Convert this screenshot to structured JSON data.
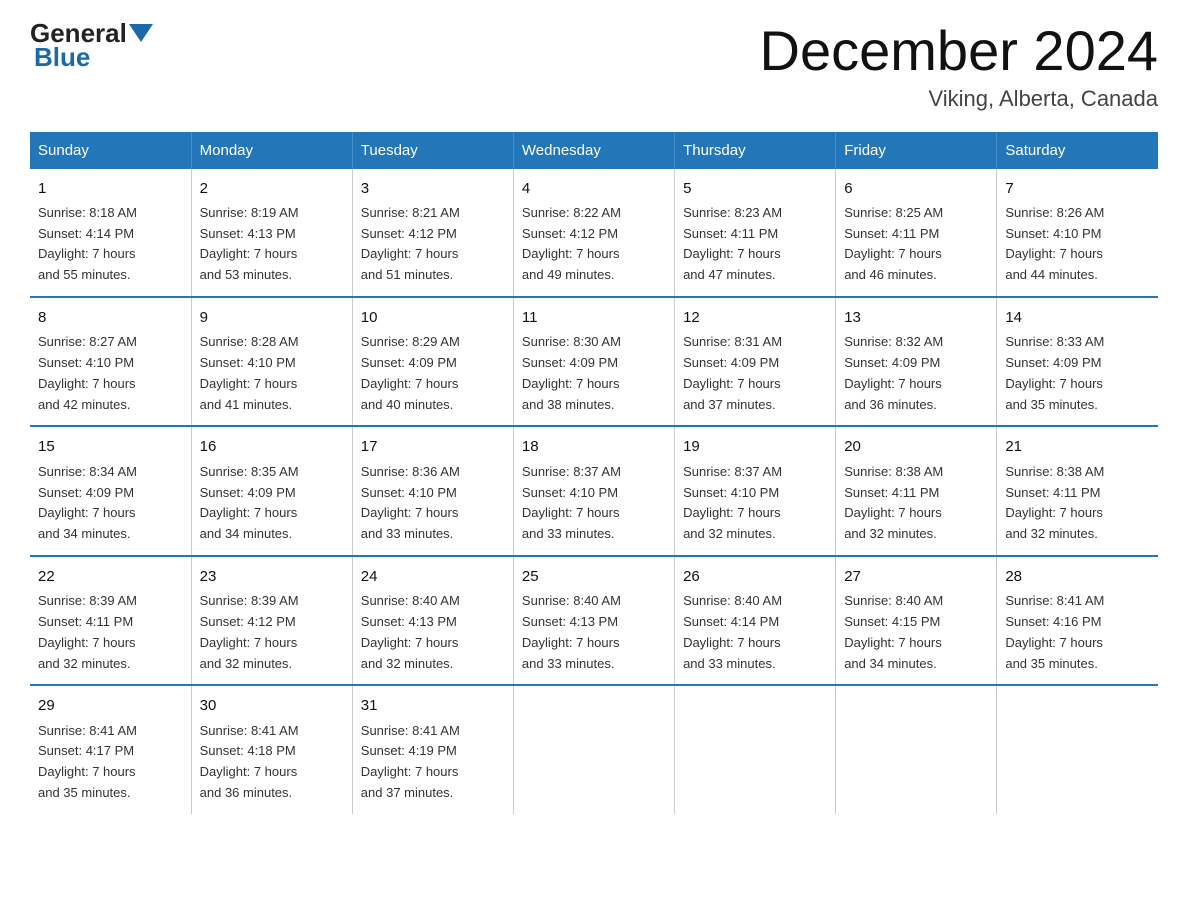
{
  "header": {
    "logo_general": "General",
    "logo_blue": "Blue",
    "main_title": "December 2024",
    "subtitle": "Viking, Alberta, Canada"
  },
  "days_of_week": [
    "Sunday",
    "Monday",
    "Tuesday",
    "Wednesday",
    "Thursday",
    "Friday",
    "Saturday"
  ],
  "weeks": [
    [
      {
        "day": "1",
        "sunrise": "8:18 AM",
        "sunset": "4:14 PM",
        "daylight": "7 hours and 55 minutes."
      },
      {
        "day": "2",
        "sunrise": "8:19 AM",
        "sunset": "4:13 PM",
        "daylight": "7 hours and 53 minutes."
      },
      {
        "day": "3",
        "sunrise": "8:21 AM",
        "sunset": "4:12 PM",
        "daylight": "7 hours and 51 minutes."
      },
      {
        "day": "4",
        "sunrise": "8:22 AM",
        "sunset": "4:12 PM",
        "daylight": "7 hours and 49 minutes."
      },
      {
        "day": "5",
        "sunrise": "8:23 AM",
        "sunset": "4:11 PM",
        "daylight": "7 hours and 47 minutes."
      },
      {
        "day": "6",
        "sunrise": "8:25 AM",
        "sunset": "4:11 PM",
        "daylight": "7 hours and 46 minutes."
      },
      {
        "day": "7",
        "sunrise": "8:26 AM",
        "sunset": "4:10 PM",
        "daylight": "7 hours and 44 minutes."
      }
    ],
    [
      {
        "day": "8",
        "sunrise": "8:27 AM",
        "sunset": "4:10 PM",
        "daylight": "7 hours and 42 minutes."
      },
      {
        "day": "9",
        "sunrise": "8:28 AM",
        "sunset": "4:10 PM",
        "daylight": "7 hours and 41 minutes."
      },
      {
        "day": "10",
        "sunrise": "8:29 AM",
        "sunset": "4:09 PM",
        "daylight": "7 hours and 40 minutes."
      },
      {
        "day": "11",
        "sunrise": "8:30 AM",
        "sunset": "4:09 PM",
        "daylight": "7 hours and 38 minutes."
      },
      {
        "day": "12",
        "sunrise": "8:31 AM",
        "sunset": "4:09 PM",
        "daylight": "7 hours and 37 minutes."
      },
      {
        "day": "13",
        "sunrise": "8:32 AM",
        "sunset": "4:09 PM",
        "daylight": "7 hours and 36 minutes."
      },
      {
        "day": "14",
        "sunrise": "8:33 AM",
        "sunset": "4:09 PM",
        "daylight": "7 hours and 35 minutes."
      }
    ],
    [
      {
        "day": "15",
        "sunrise": "8:34 AM",
        "sunset": "4:09 PM",
        "daylight": "7 hours and 34 minutes."
      },
      {
        "day": "16",
        "sunrise": "8:35 AM",
        "sunset": "4:09 PM",
        "daylight": "7 hours and 34 minutes."
      },
      {
        "day": "17",
        "sunrise": "8:36 AM",
        "sunset": "4:10 PM",
        "daylight": "7 hours and 33 minutes."
      },
      {
        "day": "18",
        "sunrise": "8:37 AM",
        "sunset": "4:10 PM",
        "daylight": "7 hours and 33 minutes."
      },
      {
        "day": "19",
        "sunrise": "8:37 AM",
        "sunset": "4:10 PM",
        "daylight": "7 hours and 32 minutes."
      },
      {
        "day": "20",
        "sunrise": "8:38 AM",
        "sunset": "4:11 PM",
        "daylight": "7 hours and 32 minutes."
      },
      {
        "day": "21",
        "sunrise": "8:38 AM",
        "sunset": "4:11 PM",
        "daylight": "7 hours and 32 minutes."
      }
    ],
    [
      {
        "day": "22",
        "sunrise": "8:39 AM",
        "sunset": "4:11 PM",
        "daylight": "7 hours and 32 minutes."
      },
      {
        "day": "23",
        "sunrise": "8:39 AM",
        "sunset": "4:12 PM",
        "daylight": "7 hours and 32 minutes."
      },
      {
        "day": "24",
        "sunrise": "8:40 AM",
        "sunset": "4:13 PM",
        "daylight": "7 hours and 32 minutes."
      },
      {
        "day": "25",
        "sunrise": "8:40 AM",
        "sunset": "4:13 PM",
        "daylight": "7 hours and 33 minutes."
      },
      {
        "day": "26",
        "sunrise": "8:40 AM",
        "sunset": "4:14 PM",
        "daylight": "7 hours and 33 minutes."
      },
      {
        "day": "27",
        "sunrise": "8:40 AM",
        "sunset": "4:15 PM",
        "daylight": "7 hours and 34 minutes."
      },
      {
        "day": "28",
        "sunrise": "8:41 AM",
        "sunset": "4:16 PM",
        "daylight": "7 hours and 35 minutes."
      }
    ],
    [
      {
        "day": "29",
        "sunrise": "8:41 AM",
        "sunset": "4:17 PM",
        "daylight": "7 hours and 35 minutes."
      },
      {
        "day": "30",
        "sunrise": "8:41 AM",
        "sunset": "4:18 PM",
        "daylight": "7 hours and 36 minutes."
      },
      {
        "day": "31",
        "sunrise": "8:41 AM",
        "sunset": "4:19 PM",
        "daylight": "7 hours and 37 minutes."
      },
      null,
      null,
      null,
      null
    ]
  ],
  "labels": {
    "sunrise": "Sunrise:",
    "sunset": "Sunset:",
    "daylight": "Daylight:"
  }
}
